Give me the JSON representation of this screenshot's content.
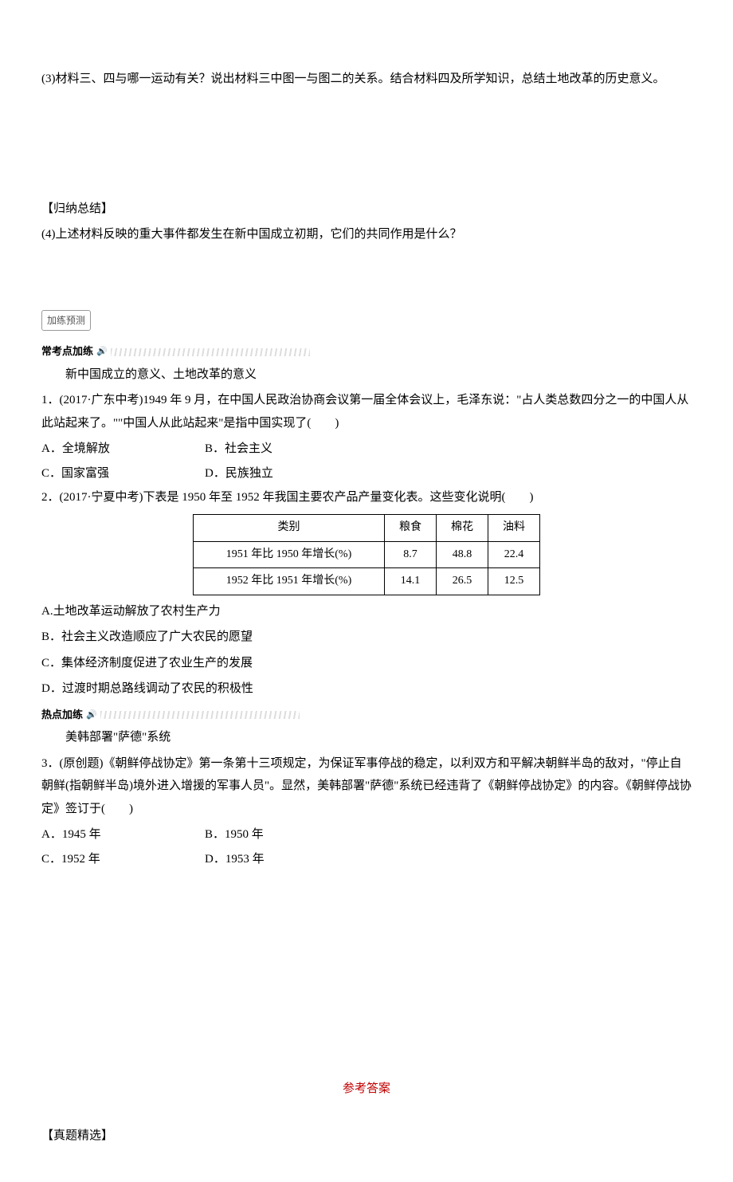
{
  "q3": {
    "text": "(3)材料三、四与哪一运动有关？说出材料三中图一与图二的关系。结合材料四及所学知识，总结土地改革的历史意义。"
  },
  "summary": {
    "header": "【归纳总结】",
    "q4": "(4)上述材料反映的重大事件都发生在新中国成立初期，它们的共同作用是什么？"
  },
  "predict_label": "加练预测",
  "common_section": {
    "label": "常考点加练",
    "topic": "新中国成立的意义、土地改革的意义"
  },
  "q1": {
    "stem": "1．(2017·广东中考)1949 年 9 月，在中国人民政治协商会议第一届全体会议上，毛泽东说：\"占人类总数四分之一的中国人从此站起来了。\"\"中国人从此站起来\"是指中国实现了(　　)",
    "optA": "A．全境解放",
    "optB": "B．社会主义",
    "optC": "C．国家富强",
    "optD": "D．民族独立"
  },
  "q2": {
    "stem": "2．(2017·宁夏中考)下表是 1950 年至 1952 年我国主要农产品产量变化表。这些变化说明(　　)",
    "optA": "A.土地改革运动解放了农村生产力",
    "optB": "B．社会主义改造顺应了广大农民的愿望",
    "optC": "C．集体经济制度促进了农业生产的发展",
    "optD": "D．过渡时期总路线调动了农民的积极性"
  },
  "chart_data": {
    "type": "table",
    "headers": [
      "类别",
      "粮食",
      "棉花",
      "油料"
    ],
    "rows": [
      {
        "label": "1951 年比 1950 年增长(%)",
        "values": [
          "8.7",
          "48.8",
          "22.4"
        ]
      },
      {
        "label": "1952 年比 1951 年增长(%)",
        "values": [
          "14.1",
          "26.5",
          "12.5"
        ]
      }
    ]
  },
  "hot_section": {
    "label": "热点加练",
    "topic": "美韩部署\"萨德\"系统"
  },
  "q3b": {
    "stem": "3．(原创题)《朝鲜停战协定》第一条第十三项规定，为保证军事停战的稳定，以利双方和平解决朝鲜半岛的敌对，\"停止自朝鲜(指朝鲜半岛)境外进入增援的军事人员\"。显然，美韩部署\"萨德\"系统已经违背了《朝鲜停战协定》的内容。《朝鲜停战协定》签订于(　　)",
    "optA": "A．1945 年",
    "optB": "B．1950 年",
    "optC": "C．1952 年",
    "optD": "D．1953 年"
  },
  "answers_title": "参考答案",
  "true_section": "【真题精选】"
}
